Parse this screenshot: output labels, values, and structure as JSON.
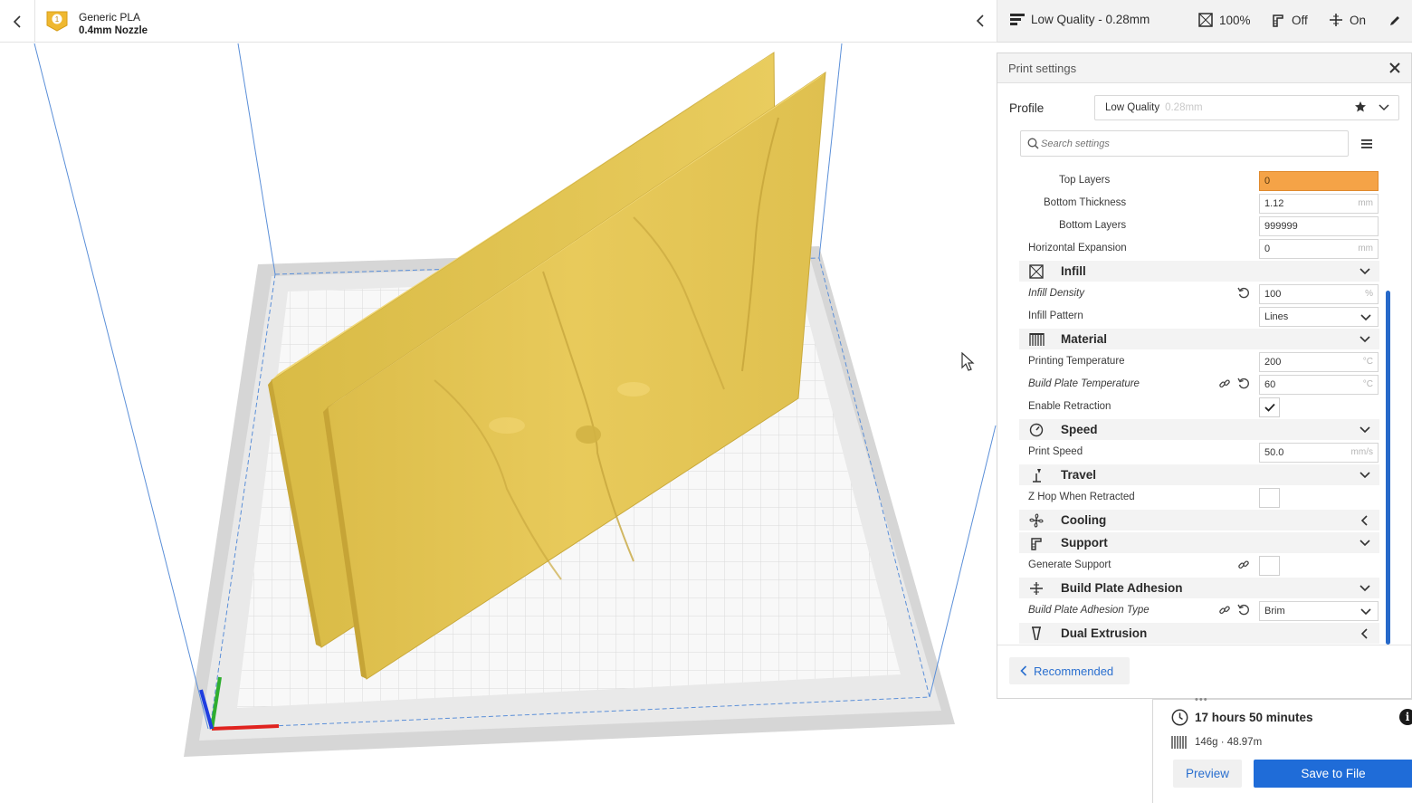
{
  "header": {
    "material": "Generic PLA",
    "nozzle": "0.4mm Nozzle",
    "badge": "1",
    "quality": "Low Quality - 0.28mm",
    "infill": "100%",
    "support": "Off",
    "adhesion": "On"
  },
  "panel": {
    "title": "Print settings",
    "profile_label": "Profile",
    "profile_name": "Low Quality",
    "profile_height": "0.28mm",
    "search_placeholder": "Search settings",
    "recommended_label": "Recommended"
  },
  "settings": {
    "top_layers": {
      "label": "Top Layers",
      "value": "0"
    },
    "bottom_thickness": {
      "label": "Bottom Thickness",
      "value": "1.12",
      "unit": "mm"
    },
    "bottom_layers": {
      "label": "Bottom Layers",
      "value": "999999"
    },
    "horizontal_expansion": {
      "label": "Horizontal Expansion",
      "value": "0",
      "unit": "mm"
    },
    "infill_title": "Infill",
    "infill_density": {
      "label": "Infill Density",
      "value": "100",
      "unit": "%"
    },
    "infill_pattern": {
      "label": "Infill Pattern",
      "value": "Lines"
    },
    "material_title": "Material",
    "printing_temperature": {
      "label": "Printing Temperature",
      "value": "200",
      "unit": "°C"
    },
    "build_plate_temperature": {
      "label": "Build Plate Temperature",
      "value": "60",
      "unit": "°C"
    },
    "enable_retraction": {
      "label": "Enable Retraction"
    },
    "speed_title": "Speed",
    "print_speed": {
      "label": "Print Speed",
      "value": "50.0",
      "unit": "mm/s"
    },
    "travel_title": "Travel",
    "z_hop": {
      "label": "Z Hop When Retracted"
    },
    "cooling_title": "Cooling",
    "support_title": "Support",
    "generate_support": {
      "label": "Generate Support"
    },
    "adhesion_title": "Build Plate Adhesion",
    "adhesion_type": {
      "label": "Build Plate Adhesion Type",
      "value": "Brim"
    },
    "dual_title": "Dual Extrusion"
  },
  "estimate": {
    "time": "17 hours 50 minutes",
    "material": "146g · 48.97m",
    "preview_label": "Preview",
    "save_label": "Save to File",
    "info_glyph": "i"
  },
  "colors": {
    "accent": "#1f6cd8",
    "warning_field": "#f5a347",
    "model": "#e2c253",
    "scrollbar": "#2769c9"
  }
}
